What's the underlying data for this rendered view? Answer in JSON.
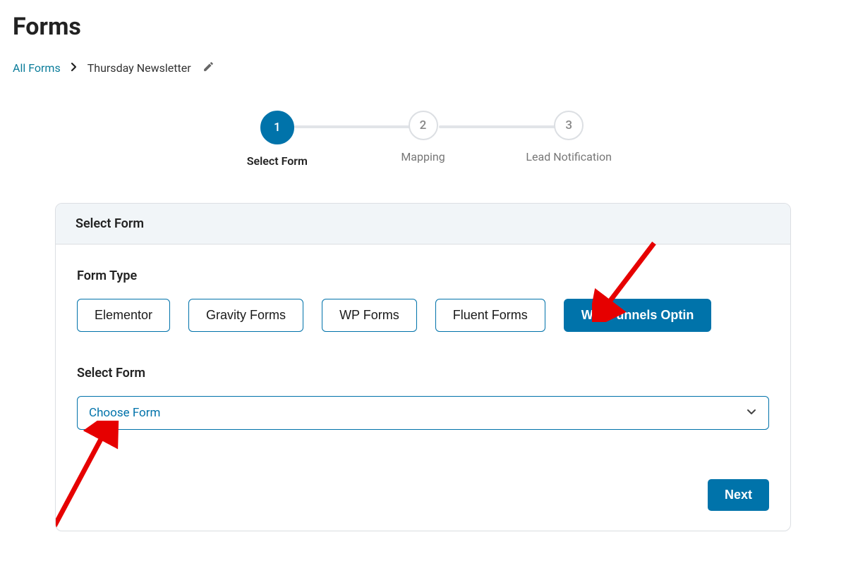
{
  "page": {
    "title": "Forms"
  },
  "breadcrumb": {
    "root": "All Forms",
    "current": "Thursday Newsletter"
  },
  "steps": [
    {
      "num": "1",
      "label": "Select Form",
      "active": true
    },
    {
      "num": "2",
      "label": "Mapping",
      "active": false
    },
    {
      "num": "3",
      "label": "Lead Notification",
      "active": false
    }
  ],
  "card": {
    "header": "Select Form",
    "form_type_label": "Form Type",
    "types": [
      {
        "label": "Elementor",
        "selected": false
      },
      {
        "label": "Gravity Forms",
        "selected": false
      },
      {
        "label": "WP Forms",
        "selected": false
      },
      {
        "label": "Fluent Forms",
        "selected": false
      },
      {
        "label": "WooFunnels Optin",
        "selected": true
      }
    ],
    "select_form_label": "Select Form",
    "select_placeholder": "Choose Form",
    "next_button": "Next"
  }
}
